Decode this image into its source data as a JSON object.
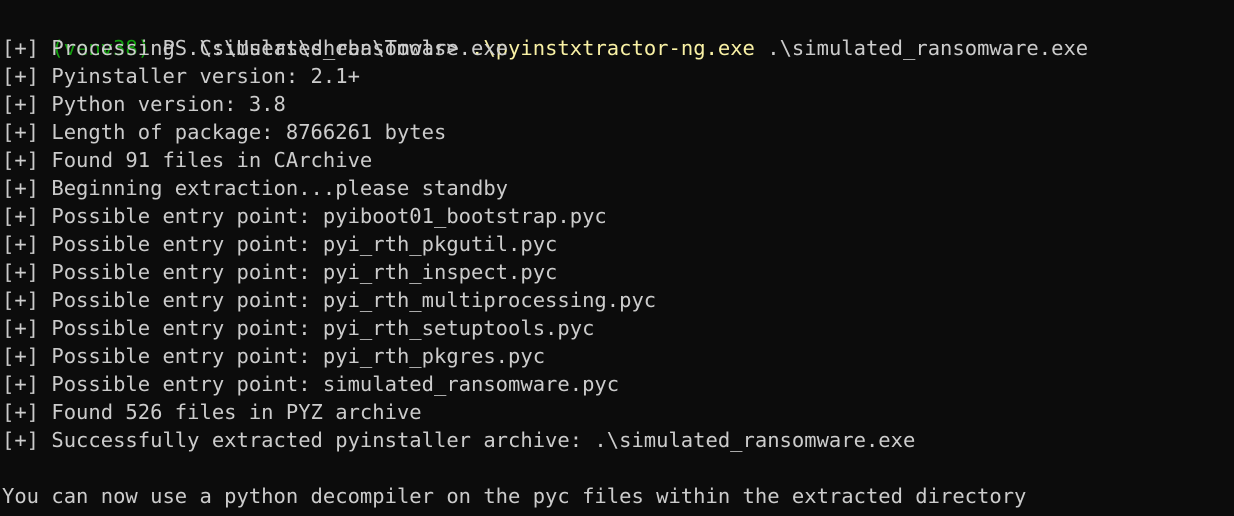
{
  "prompt": {
    "venv": "(venv38)",
    "ps": " PS C:\\Users\\sheba\\Tools> ",
    "command": ".\\pyinstxtractor-ng.exe",
    "argument": " .\\simulated_ransomware.exe"
  },
  "output_lines": [
    "[+] Processing .\\simulated_ransomware.exe",
    "[+] Pyinstaller version: 2.1+",
    "[+] Python version: 3.8",
    "[+] Length of package: 8766261 bytes",
    "[+] Found 91 files in CArchive",
    "[+] Beginning extraction...please standby",
    "[+] Possible entry point: pyiboot01_bootstrap.pyc",
    "[+] Possible entry point: pyi_rth_pkgutil.pyc",
    "[+] Possible entry point: pyi_rth_inspect.pyc",
    "[+] Possible entry point: pyi_rth_multiprocessing.pyc",
    "[+] Possible entry point: pyi_rth_setuptools.pyc",
    "[+] Possible entry point: pyi_rth_pkgres.pyc",
    "[+] Possible entry point: simulated_ransomware.pyc",
    "[+] Found 526 files in PYZ archive",
    "[+] Successfully extracted pyinstaller archive: .\\simulated_ransomware.exe",
    "",
    "You can now use a python decompiler on the pyc files within the extracted directory"
  ],
  "colors": {
    "background": "#0c0c0c",
    "text": "#cccccc",
    "venv": "#13a10e",
    "command": "#f9f1a5"
  }
}
